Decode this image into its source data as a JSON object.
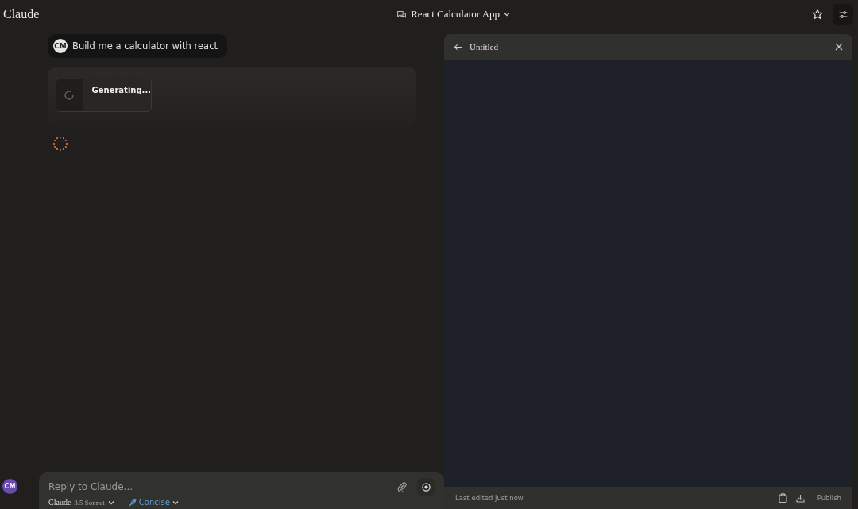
{
  "header": {
    "logo": "Claude",
    "title": "React Calculator App"
  },
  "messages": [
    {
      "avatar": "CM",
      "text": "Build me a calculator with react"
    }
  ],
  "artifact_card": {
    "status": "Generating..."
  },
  "composer": {
    "user_avatar": "CM",
    "placeholder": "Reply to Claude...",
    "model": "Claude",
    "model_version": "3.5 Sonnet",
    "style": "Concise"
  },
  "panel": {
    "title": "Untitled",
    "footer_text": "Last edited just now",
    "publish": "Publish"
  }
}
